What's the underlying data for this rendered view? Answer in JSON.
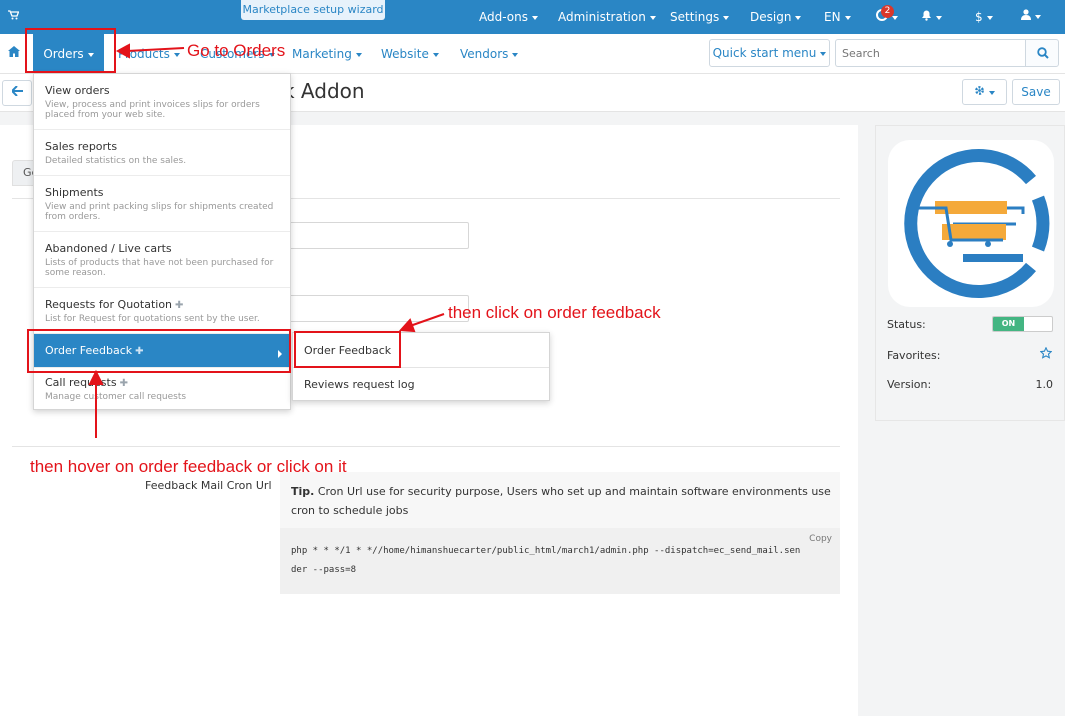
{
  "topbar": {
    "wizard_label": "Marketplace setup wizard",
    "addons": "Add-ons",
    "administration": "Administration",
    "settings": "Settings",
    "design": "Design",
    "language": "EN",
    "notification_count": "2",
    "currency": "$"
  },
  "nav": {
    "orders": "Orders",
    "products": "Products",
    "customers": "Customers",
    "marketing": "Marketing",
    "website": "Website",
    "vendors": "Vendors",
    "quick_start": "Quick start menu",
    "search_placeholder": "Search"
  },
  "page": {
    "title": "ck Addon",
    "save_label": "Save",
    "tab_general": "Ge",
    "cron_label": "Feedback Mail Cron Url",
    "tip_bold": "Tip.",
    "tip_text": " Cron Url use for security purpose, Users who set up and maintain software environments use cron to schedule jobs",
    "copy_label": "Copy",
    "code": "php * * */1 * *//home/himanshuecarter/public_html/march1/admin.php --dispatch=ec_send_mail.sender --pass=8"
  },
  "sidebar": {
    "status_label": "Status:",
    "status_value": "ON",
    "favorites_label": "Favorites:",
    "version_label": "Version:",
    "version_value": "1.0"
  },
  "dropdown": {
    "items": [
      {
        "title": "View orders",
        "desc": "View, process and print invoices slips for orders placed from your web site."
      },
      {
        "title": "Sales reports",
        "desc": "Detailed statistics on the sales."
      },
      {
        "title": "Shipments",
        "desc": "View and print packing slips for shipments created from orders."
      },
      {
        "title": "Abandoned / Live carts",
        "desc": "Lists of products that have not been purchased for some reason."
      },
      {
        "title": "Requests for Quotation",
        "desc": "List for Request for quotations sent by the user."
      },
      {
        "title": "Order Feedback",
        "desc": ""
      },
      {
        "title": "Call requests",
        "desc": "Manage customer call requests"
      }
    ],
    "submenu": [
      "Order Feedback",
      "Reviews request log"
    ]
  },
  "annotations": {
    "step1": "Go to Orders",
    "step2": "then hover on order feedback or click on it",
    "step3": "then click on order feedback",
    "color": "#e3131a"
  },
  "colors": {
    "accent": "#2a86c5",
    "status_on": "#43b582",
    "annotation": "#e3131a"
  }
}
